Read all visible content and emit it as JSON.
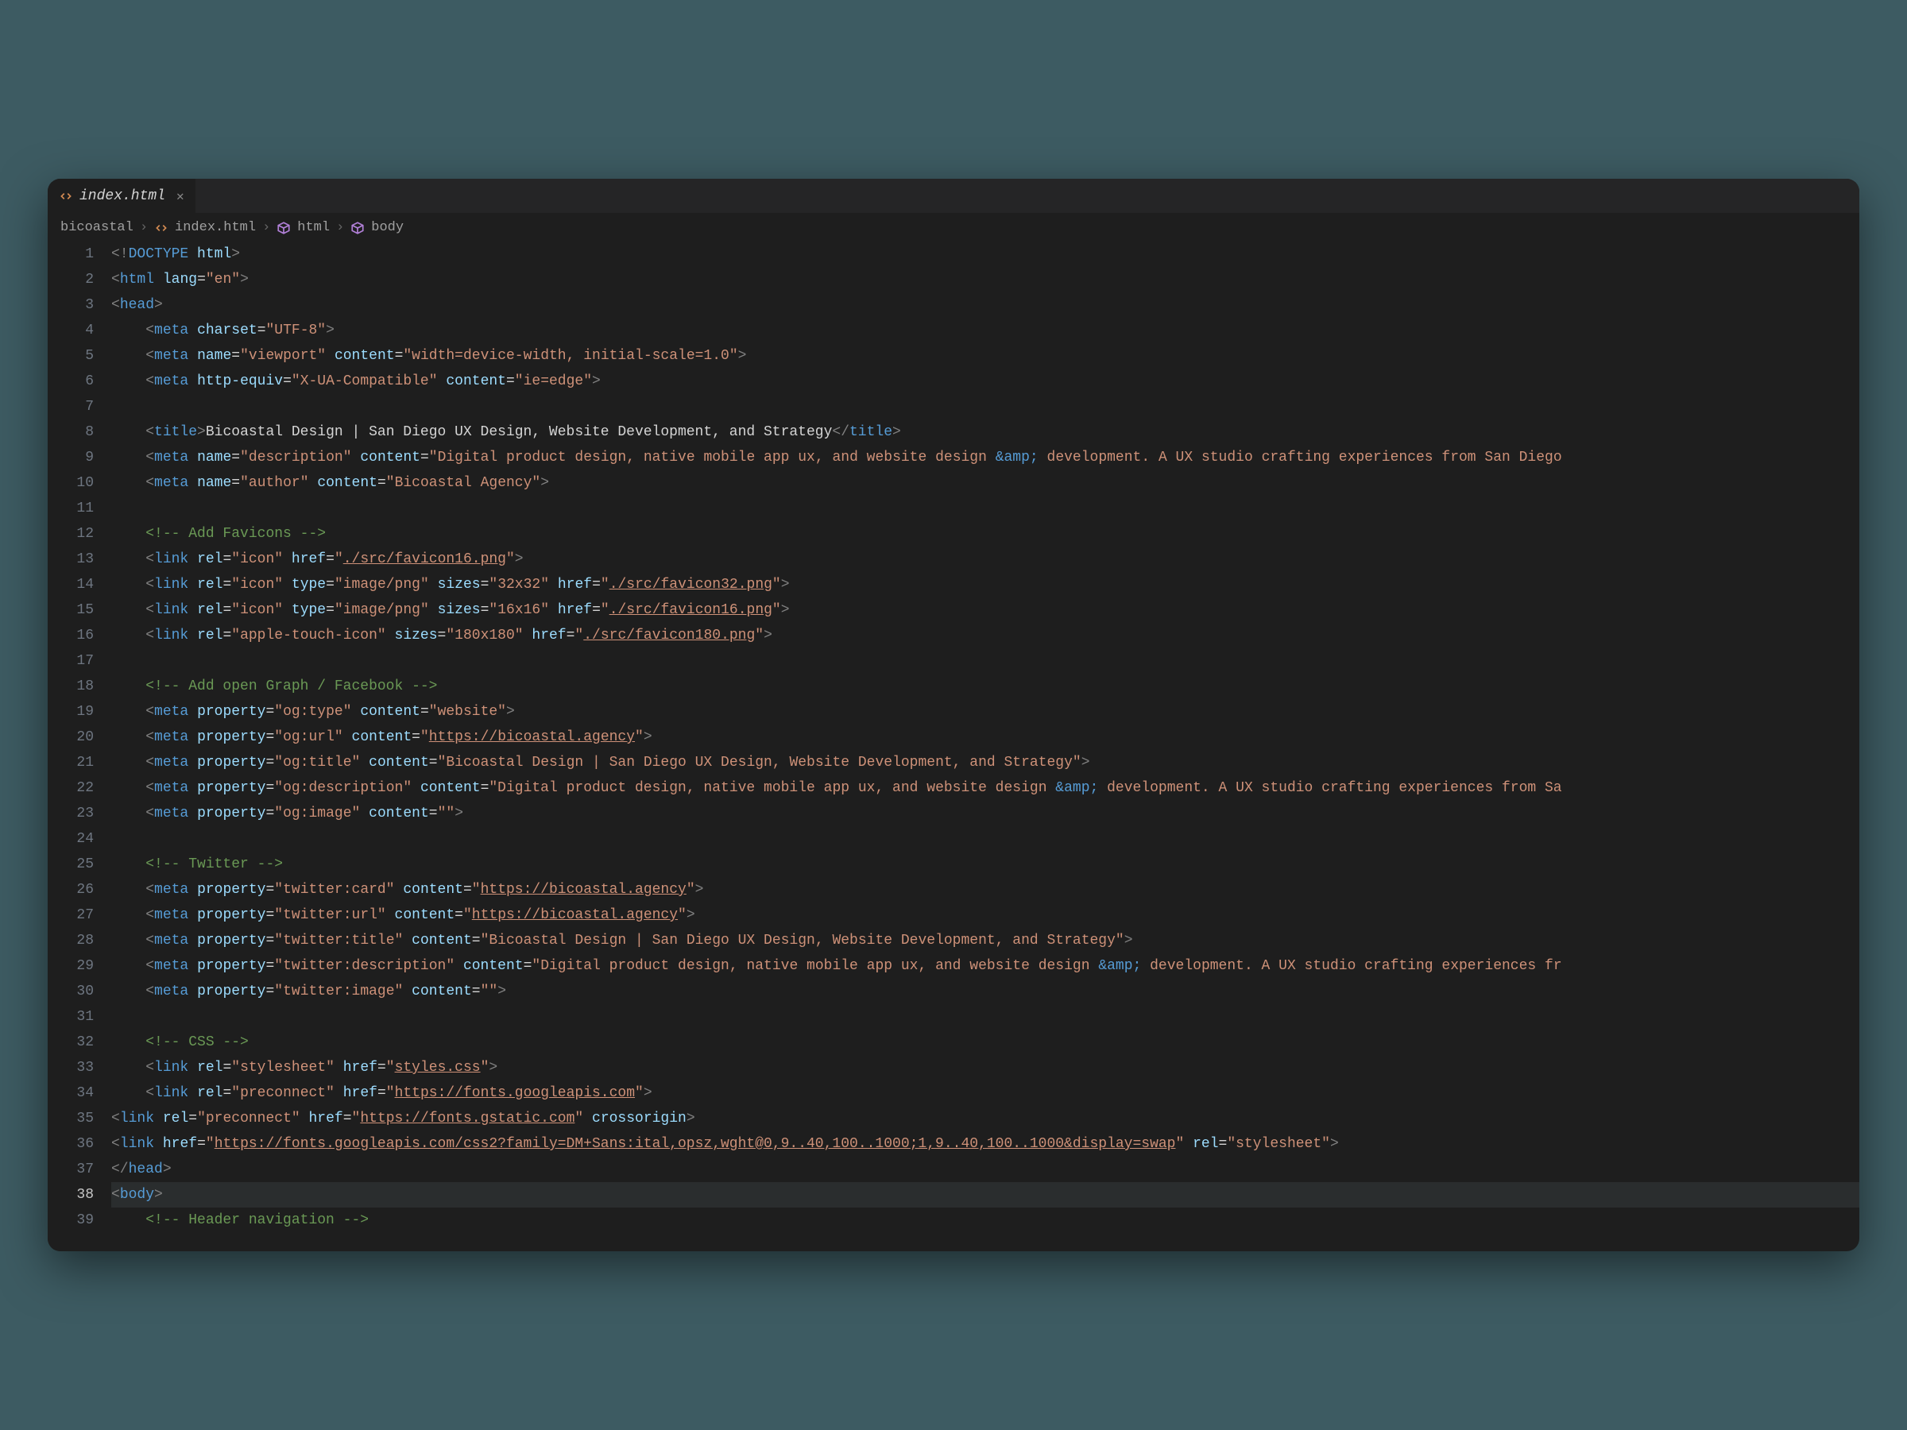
{
  "tab": {
    "filename": "index.html"
  },
  "breadcrumbs": [
    "bicoastal",
    "index.html",
    "html",
    "body"
  ],
  "line_start": 1,
  "active_line": 38,
  "code_lines": [
    {
      "i": 1,
      "t": 0,
      "html": "<span class='gray'>&lt;!</span><span class='blue'>DOCTYPE</span> <span class='lblue'>html</span><span class='gray'>&gt;</span>"
    },
    {
      "i": 2,
      "t": 0,
      "html": "<span class='gray'>&lt;</span><span class='blue'>html</span> <span class='lblue'>lang</span>=<span class='str'>\"en\"</span><span class='gray'>&gt;</span>"
    },
    {
      "i": 3,
      "t": 0,
      "html": "<span class='gray'>&lt;</span><span class='blue'>head</span><span class='gray'>&gt;</span>"
    },
    {
      "i": 4,
      "t": 1,
      "html": "<span class='gray'>&lt;</span><span class='blue'>meta</span> <span class='lblue'>charset</span>=<span class='str'>\"UTF-8\"</span><span class='gray'>&gt;</span>"
    },
    {
      "i": 5,
      "t": 1,
      "html": "<span class='gray'>&lt;</span><span class='blue'>meta</span> <span class='lblue'>name</span>=<span class='str'>\"viewport\"</span> <span class='lblue'>content</span>=<span class='str'>\"width=device-width, initial-scale=1.0\"</span><span class='gray'>&gt;</span>"
    },
    {
      "i": 6,
      "t": 1,
      "html": "<span class='gray'>&lt;</span><span class='blue'>meta</span> <span class='lblue'>http-equiv</span>=<span class='str'>\"X-UA-Compatible\"</span> <span class='lblue'>content</span>=<span class='str'>\"ie=edge\"</span><span class='gray'>&gt;</span>"
    },
    {
      "i": 7,
      "t": 1,
      "html": ""
    },
    {
      "i": 8,
      "t": 1,
      "html": "<span class='gray'>&lt;</span><span class='blue'>title</span><span class='gray'>&gt;</span>Bicoastal Design | San Diego UX Design, Website Development, and Strategy<span class='gray'>&lt;/</span><span class='blue'>title</span><span class='gray'>&gt;</span>"
    },
    {
      "i": 9,
      "t": 1,
      "html": "<span class='gray'>&lt;</span><span class='blue'>meta</span> <span class='lblue'>name</span>=<span class='str'>\"description\"</span> <span class='lblue'>content</span>=<span class='str'>\"Digital product design, native mobile app ux, and website design </span><span class='blue'>&amp;amp;</span><span class='str'> development. A UX studio crafting experiences from San Diego</span>"
    },
    {
      "i": 10,
      "t": 1,
      "html": "<span class='gray'>&lt;</span><span class='blue'>meta</span> <span class='lblue'>name</span>=<span class='str'>\"author\"</span> <span class='lblue'>content</span>=<span class='str'>\"Bicoastal Agency\"</span><span class='gray'>&gt;</span>"
    },
    {
      "i": 11,
      "t": 1,
      "html": ""
    },
    {
      "i": 12,
      "t": 1,
      "html": "<span class='green'>&lt;!-- Add Favicons --&gt;</span>"
    },
    {
      "i": 13,
      "t": 1,
      "html": "<span class='gray'>&lt;</span><span class='blue'>link</span> <span class='lblue'>rel</span>=<span class='str'>\"icon\"</span> <span class='lblue'>href</span>=<span class='str'>\"<span class='ul'>./src/favicon16.png</span>\"</span><span class='gray'>&gt;</span>"
    },
    {
      "i": 14,
      "t": 1,
      "html": "<span class='gray'>&lt;</span><span class='blue'>link</span> <span class='lblue'>rel</span>=<span class='str'>\"icon\"</span> <span class='lblue'>type</span>=<span class='str'>\"image/png\"</span> <span class='lblue'>sizes</span>=<span class='str'>\"32x32\"</span> <span class='lblue'>href</span>=<span class='str'>\"<span class='ul'>./src/favicon32.png</span>\"</span><span class='gray'>&gt;</span>"
    },
    {
      "i": 15,
      "t": 1,
      "html": "<span class='gray'>&lt;</span><span class='blue'>link</span> <span class='lblue'>rel</span>=<span class='str'>\"icon\"</span> <span class='lblue'>type</span>=<span class='str'>\"image/png\"</span> <span class='lblue'>sizes</span>=<span class='str'>\"16x16\"</span> <span class='lblue'>href</span>=<span class='str'>\"<span class='ul'>./src/favicon16.png</span>\"</span><span class='gray'>&gt;</span>"
    },
    {
      "i": 16,
      "t": 1,
      "html": "<span class='gray'>&lt;</span><span class='blue'>link</span> <span class='lblue'>rel</span>=<span class='str'>\"apple-touch-icon\"</span> <span class='lblue'>sizes</span>=<span class='str'>\"180x180\"</span> <span class='lblue'>href</span>=<span class='str'>\"<span class='ul'>./src/favicon180.png</span>\"</span><span class='gray'>&gt;</span>"
    },
    {
      "i": 17,
      "t": 1,
      "html": ""
    },
    {
      "i": 18,
      "t": 1,
      "html": "<span class='green'>&lt;!-- Add open Graph / Facebook --&gt;</span>"
    },
    {
      "i": 19,
      "t": 1,
      "html": "<span class='gray'>&lt;</span><span class='blue'>meta</span> <span class='lblue'>property</span>=<span class='str'>\"og:type\"</span> <span class='lblue'>content</span>=<span class='str'>\"website\"</span><span class='gray'>&gt;</span>"
    },
    {
      "i": 20,
      "t": 1,
      "html": "<span class='gray'>&lt;</span><span class='blue'>meta</span> <span class='lblue'>property</span>=<span class='str'>\"og:url\"</span> <span class='lblue'>content</span>=<span class='str'>\"<span class='ul'>https://bicoastal.agency</span>\"</span><span class='gray'>&gt;</span>"
    },
    {
      "i": 21,
      "t": 1,
      "html": "<span class='gray'>&lt;</span><span class='blue'>meta</span> <span class='lblue'>property</span>=<span class='str'>\"og:title\"</span> <span class='lblue'>content</span>=<span class='str'>\"Bicoastal Design | San Diego UX Design, Website Development, and Strategy\"</span><span class='gray'>&gt;</span>"
    },
    {
      "i": 22,
      "t": 1,
      "html": "<span class='gray'>&lt;</span><span class='blue'>meta</span> <span class='lblue'>property</span>=<span class='str'>\"og:description\"</span> <span class='lblue'>content</span>=<span class='str'>\"Digital product design, native mobile app ux, and website design </span><span class='blue'>&amp;amp;</span><span class='str'> development. A UX studio crafting experiences from Sa</span>"
    },
    {
      "i": 23,
      "t": 1,
      "html": "<span class='gray'>&lt;</span><span class='blue'>meta</span> <span class='lblue'>property</span>=<span class='str'>\"og:image\"</span> <span class='lblue'>content</span>=<span class='str'>\"\"</span><span class='gray'>&gt;</span>"
    },
    {
      "i": 24,
      "t": 1,
      "html": ""
    },
    {
      "i": 25,
      "t": 1,
      "html": "<span class='green'>&lt;!-- Twitter --&gt;</span>"
    },
    {
      "i": 26,
      "t": 1,
      "html": "<span class='gray'>&lt;</span><span class='blue'>meta</span> <span class='lblue'>property</span>=<span class='str'>\"twitter:card\"</span> <span class='lblue'>content</span>=<span class='str'>\"<span class='ul'>https://bicoastal.agency</span>\"</span><span class='gray'>&gt;</span>"
    },
    {
      "i": 27,
      "t": 1,
      "html": "<span class='gray'>&lt;</span><span class='blue'>meta</span> <span class='lblue'>property</span>=<span class='str'>\"twitter:url\"</span> <span class='lblue'>content</span>=<span class='str'>\"<span class='ul'>https://bicoastal.agency</span>\"</span><span class='gray'>&gt;</span>"
    },
    {
      "i": 28,
      "t": 1,
      "html": "<span class='gray'>&lt;</span><span class='blue'>meta</span> <span class='lblue'>property</span>=<span class='str'>\"twitter:title\"</span> <span class='lblue'>content</span>=<span class='str'>\"Bicoastal Design | San Diego UX Design, Website Development, and Strategy\"</span><span class='gray'>&gt;</span>"
    },
    {
      "i": 29,
      "t": 1,
      "html": "<span class='gray'>&lt;</span><span class='blue'>meta</span> <span class='lblue'>property</span>=<span class='str'>\"twitter:description\"</span> <span class='lblue'>content</span>=<span class='str'>\"Digital product design, native mobile app ux, and website design </span><span class='blue'>&amp;amp;</span><span class='str'> development. A UX studio crafting experiences fr</span>"
    },
    {
      "i": 30,
      "t": 1,
      "html": "<span class='gray'>&lt;</span><span class='blue'>meta</span> <span class='lblue'>property</span>=<span class='str'>\"twitter:image\"</span> <span class='lblue'>content</span>=<span class='str'>\"\"</span><span class='gray'>&gt;</span>"
    },
    {
      "i": 31,
      "t": 1,
      "html": ""
    },
    {
      "i": 32,
      "t": 1,
      "html": "<span class='green'>&lt;!-- CSS --&gt;</span>"
    },
    {
      "i": 33,
      "t": 1,
      "html": "<span class='gray'>&lt;</span><span class='blue'>link</span> <span class='lblue'>rel</span>=<span class='str'>\"stylesheet\"</span> <span class='lblue'>href</span>=<span class='str'>\"<span class='ul'>styles.css</span>\"</span><span class='gray'>&gt;</span>"
    },
    {
      "i": 34,
      "t": 1,
      "html": "<span class='gray'>&lt;</span><span class='blue'>link</span> <span class='lblue'>rel</span>=<span class='str'>\"preconnect\"</span> <span class='lblue'>href</span>=<span class='str'>\"<span class='ul'>https://fonts.googleapis.com</span>\"</span><span class='gray'>&gt;</span>"
    },
    {
      "i": 35,
      "t": 0,
      "html": "<span class='gray'>&lt;</span><span class='blue'>link</span> <span class='lblue'>rel</span>=<span class='str'>\"preconnect\"</span> <span class='lblue'>href</span>=<span class='str'>\"<span class='ul'>https://fonts.gstatic.com</span>\"</span> <span class='lblue'>crossorigin</span><span class='gray'>&gt;</span>"
    },
    {
      "i": 36,
      "t": 0,
      "html": "<span class='gray'>&lt;</span><span class='blue'>link</span> <span class='lblue'>href</span>=<span class='str'>\"<span class='ul'>https://fonts.googleapis.com/css2?family=DM+Sans:ital,opsz,wght@0,9..40,100..1000;1,9..40,100..1000&amp;display=swap</span>\"</span> <span class='lblue'>rel</span>=<span class='str'>\"stylesheet\"</span><span class='gray'>&gt;</span>"
    },
    {
      "i": 37,
      "t": 0,
      "html": "<span class='gray'>&lt;/</span><span class='blue'>head</span><span class='gray'>&gt;</span>"
    },
    {
      "i": 38,
      "t": 0,
      "html": "<span class='gray'>&lt;</span><span class='blue'>body</span><span class='gray'>&gt;</span>"
    },
    {
      "i": 39,
      "t": 1,
      "html": "<span class='green'>&lt;!-- Header navigation --&gt;</span>"
    }
  ]
}
